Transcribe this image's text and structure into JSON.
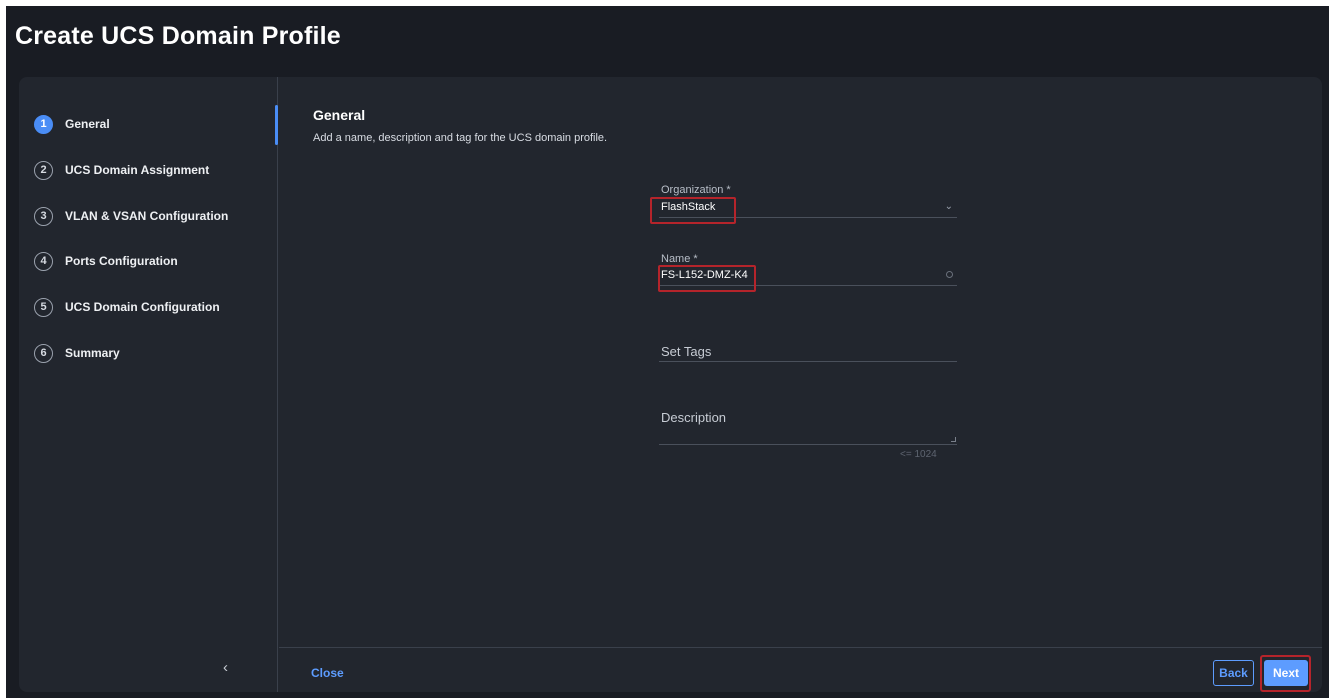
{
  "header": {
    "title": "Create UCS Domain Profile"
  },
  "sidebar": {
    "steps": [
      {
        "num": "1",
        "label": "General"
      },
      {
        "num": "2",
        "label": "UCS Domain Assignment"
      },
      {
        "num": "3",
        "label": "VLAN & VSAN Configuration"
      },
      {
        "num": "4",
        "label": "Ports Configuration"
      },
      {
        "num": "5",
        "label": "UCS Domain Configuration"
      },
      {
        "num": "6",
        "label": "Summary"
      }
    ],
    "collapse_glyph": "‹"
  },
  "main": {
    "section_title": "General",
    "section_description": "Add a name, description and tag for the UCS domain profile.",
    "organization": {
      "label": "Organization *",
      "value": "FlashStack",
      "icon": "chevron-down-icon"
    },
    "name": {
      "label": "Name *",
      "value": "FS-L152-DMZ-K4",
      "icon": "info-icon"
    },
    "tags": {
      "label": "Set Tags"
    },
    "description": {
      "label": "Description",
      "char_limit": "<= 1024"
    }
  },
  "footer": {
    "close_label": "Close",
    "back_label": "Back",
    "next_label": "Next"
  },
  "colors": {
    "accent": "#5d9cff",
    "highlight": "#b5242b",
    "background": "#191c23",
    "panel": "#22262e"
  }
}
